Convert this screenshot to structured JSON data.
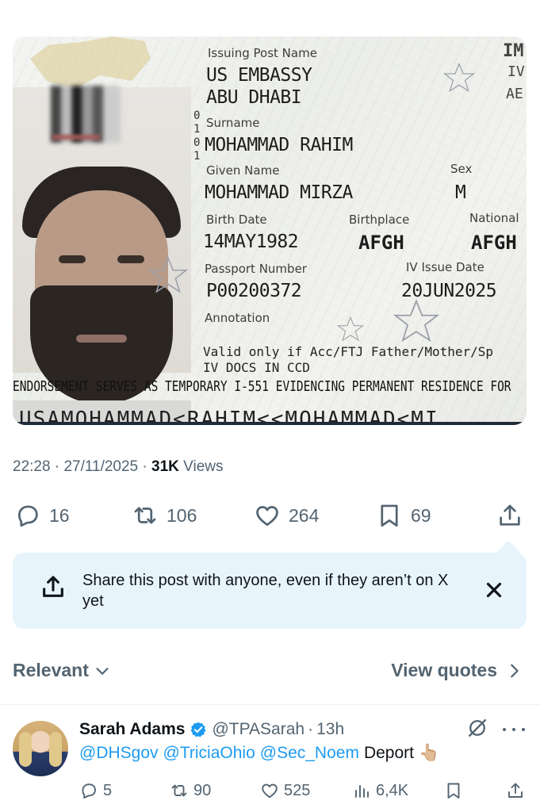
{
  "visa": {
    "issuing_post_label": "Issuing Post Name",
    "issuing_post_line1": "US EMBASSY",
    "issuing_post_line2": "ABU DHABI",
    "corner_top": "IM",
    "corner_mid": "IV",
    "corner_low": "AE",
    "visa_number_digits": "0\n1\n0\n1",
    "surname_label": "Surname",
    "surname": "MOHAMMAD RAHIM",
    "given_name_label": "Given Name",
    "given_name": "MOHAMMAD MIRZA",
    "sex_label": "Sex",
    "sex": "M",
    "birth_date_label": "Birth Date",
    "birth_date": "14MAY1982",
    "birthplace_label": "Birthplace",
    "birthplace": "AFGH",
    "nationality_label": "National",
    "nationality": "AFGH",
    "passport_number_label": "Passport Number",
    "passport_number": "P00200372",
    "issue_date_label": "IV Issue Date",
    "issue_date": "20JUN2025",
    "annotation_label": "Annotation",
    "annotation_line1": "Valid only if Acc/FTJ Father/Mother/Sp",
    "annotation_line2": "IV DOCS IN CCD",
    "endorsement": "ENDORSEMENT SERVES AS TEMPORARY I-551 EVIDENCING PERMANENT RESIDENCE FOR",
    "mrz": "USAMOHAMMAD<RAHIM<<MOHAMMAD<MI"
  },
  "meta": {
    "time": "22:28",
    "date": "27/11/2025",
    "separator": "·",
    "views_count": "31K",
    "views_label": "Views"
  },
  "actions": {
    "replies": "16",
    "reposts": "106",
    "likes": "264",
    "bookmarks": "69"
  },
  "share_tip": {
    "text": "Share this post with anyone, even if they aren’t on X yet"
  },
  "filters": {
    "sort_label": "Relevant",
    "quotes_label": "View quotes"
  },
  "reply": {
    "name": "Sarah Adams",
    "handle": "@TPASarah",
    "separator": "·",
    "time": "13h",
    "mentions": [
      "@DHSgov",
      "@TriciaOhio",
      "@Sec_Noem"
    ],
    "text": "Deport",
    "emoji": "👆🏼",
    "replies": "5",
    "reposts": "90",
    "likes": "525",
    "views": "6,4K"
  },
  "colors": {
    "accent": "#1d9bf0",
    "secondary_text": "#536471",
    "tip_background": "#e7f4fc"
  },
  "icons": [
    "reply-icon",
    "repost-icon",
    "like-icon",
    "bookmark-icon",
    "share-icon",
    "close-icon",
    "chevron-down-icon",
    "chevron-right-icon",
    "verified-badge-icon",
    "grok-icon",
    "more-icon",
    "views-icon"
  ]
}
